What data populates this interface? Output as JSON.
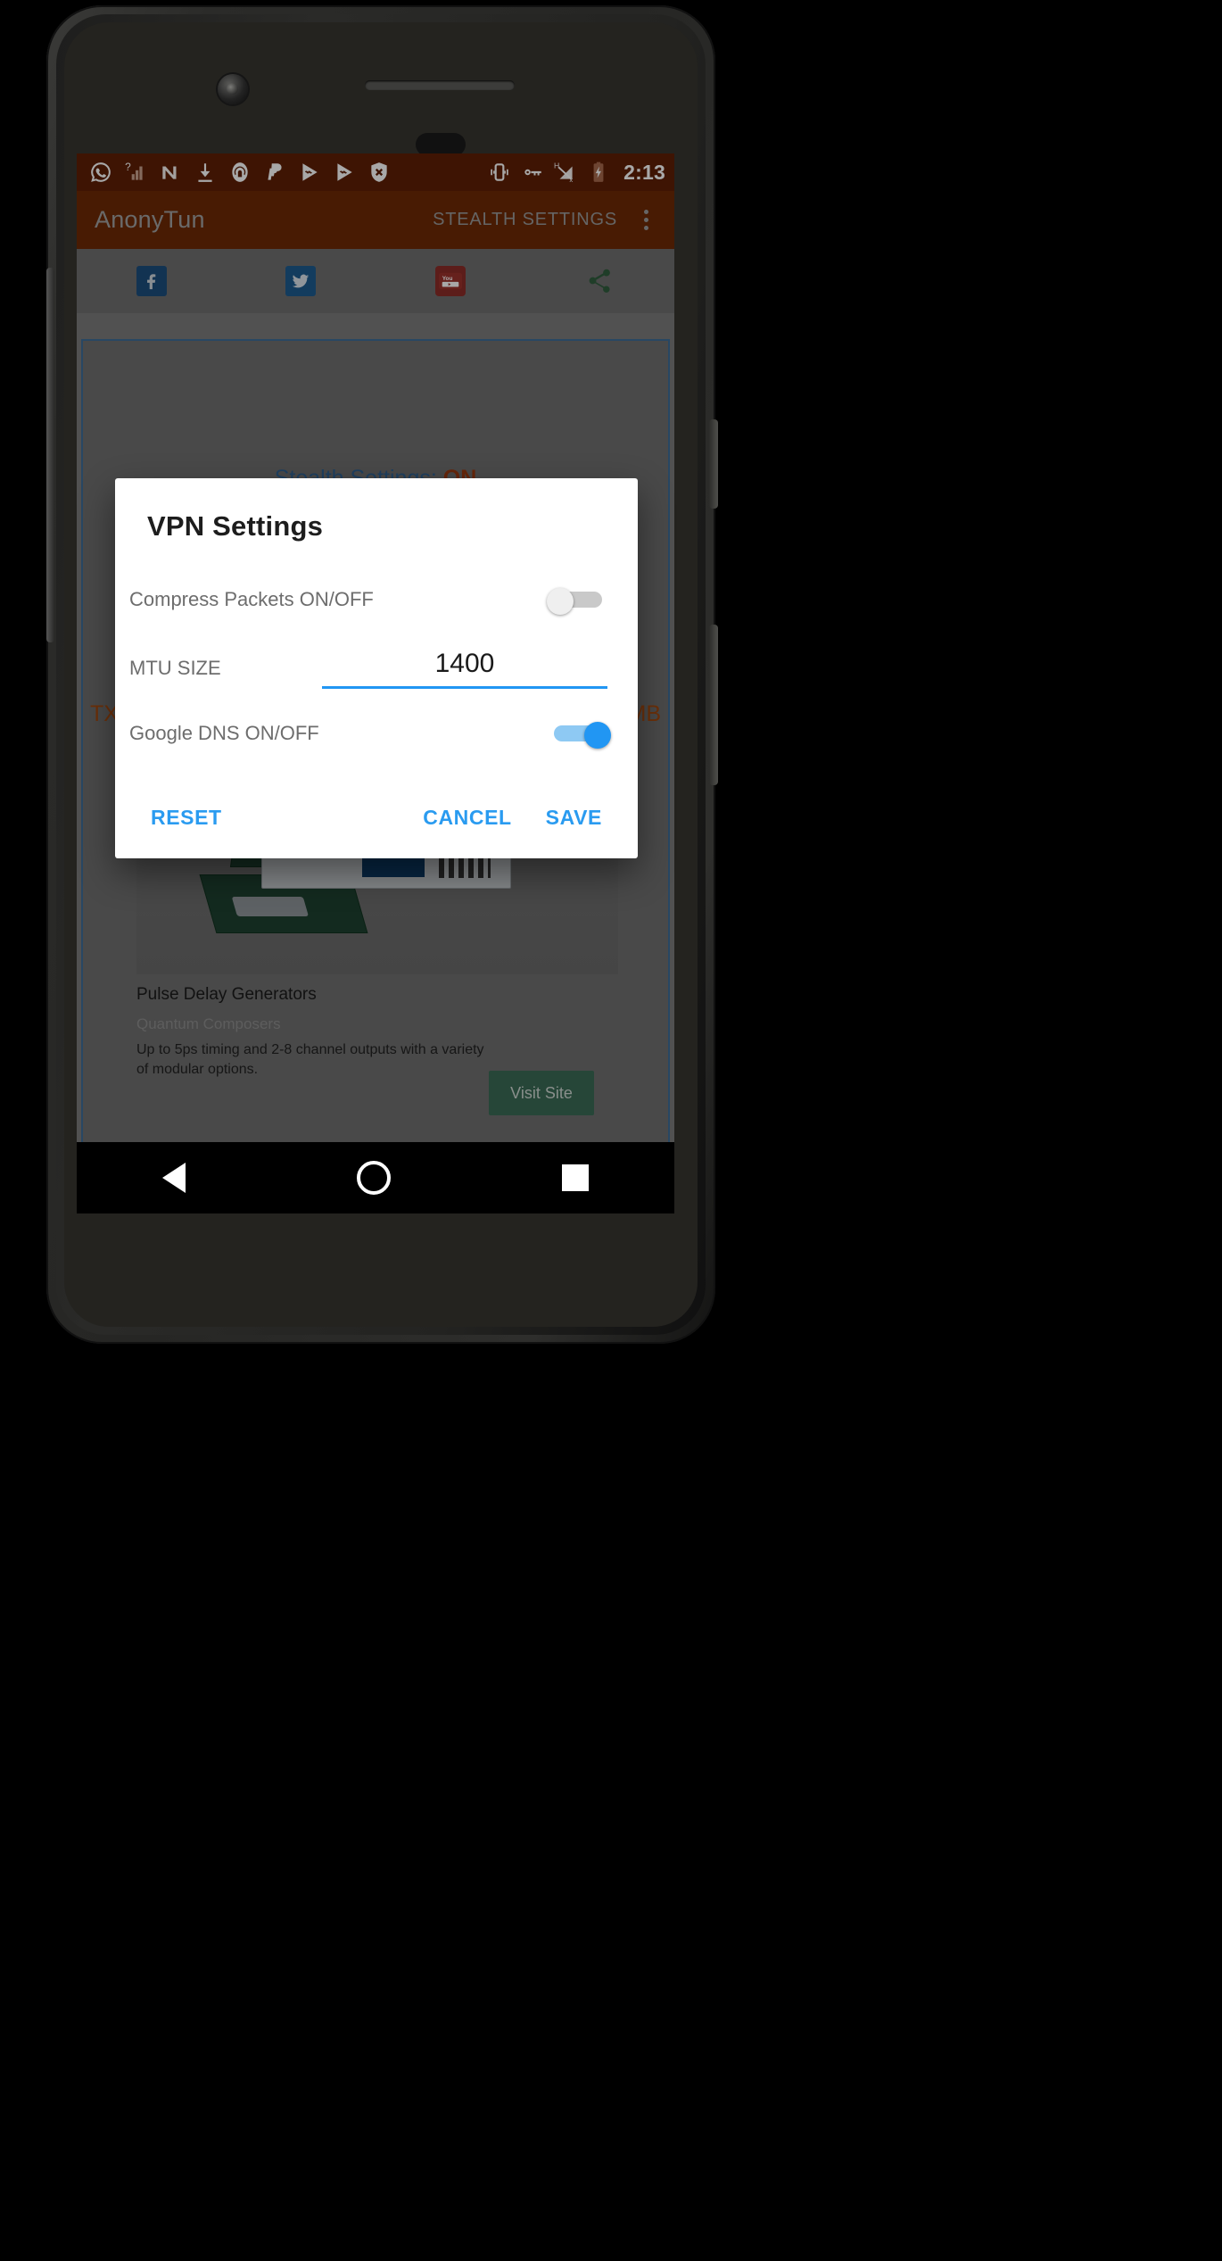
{
  "statusbar": {
    "icons_left": [
      "whatsapp-icon",
      "signal-question-icon",
      "nord-icon",
      "download-icon",
      "hotspot-icon",
      "paypal-icon",
      "play-music-icon",
      "play-music-icon-2",
      "shield-x-icon"
    ],
    "icons_right": [
      "vibrate-icon",
      "vpn-key-icon",
      "h-signal-off-icon",
      "battery-charging-icon"
    ],
    "clock": "2:13",
    "bg_color": "#5e1f06"
  },
  "appbar": {
    "title": "AnonyTun",
    "action_label": "STEALTH SETTINGS",
    "overflow": "more-options-icon",
    "bg_color": "#6e2a06"
  },
  "social": {
    "items": [
      {
        "name": "facebook-icon",
        "glyph": "f"
      },
      {
        "name": "twitter-icon",
        "glyph": "ᴠ"
      },
      {
        "name": "youtube-icon",
        "glyph": "You"
      },
      {
        "name": "share-icon",
        "glyph": "≺"
      }
    ]
  },
  "panel": {
    "stealth_prefix": "Stealth Settings: ",
    "stealth_value": "ON",
    "tx_left": "TX",
    "tx_right": "MB",
    "border_color": "#3e6d96"
  },
  "ad_card": {
    "title": "Pulse Delay Generators",
    "brand": "Quantum Composers",
    "description": "Up to 5ps timing and 2-8 channel outputs with a variety of modular options.",
    "cta": "Visit Site"
  },
  "dialog": {
    "title": "VPN Settings",
    "rows": [
      {
        "label": "Compress Packets ON/OFF",
        "control": "switch",
        "state": "off"
      },
      {
        "label": "MTU SIZE",
        "control": "textfield",
        "value": "1400"
      },
      {
        "label": "Google DNS ON/OFF",
        "control": "switch",
        "state": "on"
      }
    ],
    "buttons": {
      "reset": "RESET",
      "cancel": "CANCEL",
      "save": "SAVE"
    },
    "accent_color": "#2a9bf0"
  },
  "navbar": {
    "back": "back-triangle-icon",
    "home": "home-circle-icon",
    "recents": "recents-square-icon"
  }
}
